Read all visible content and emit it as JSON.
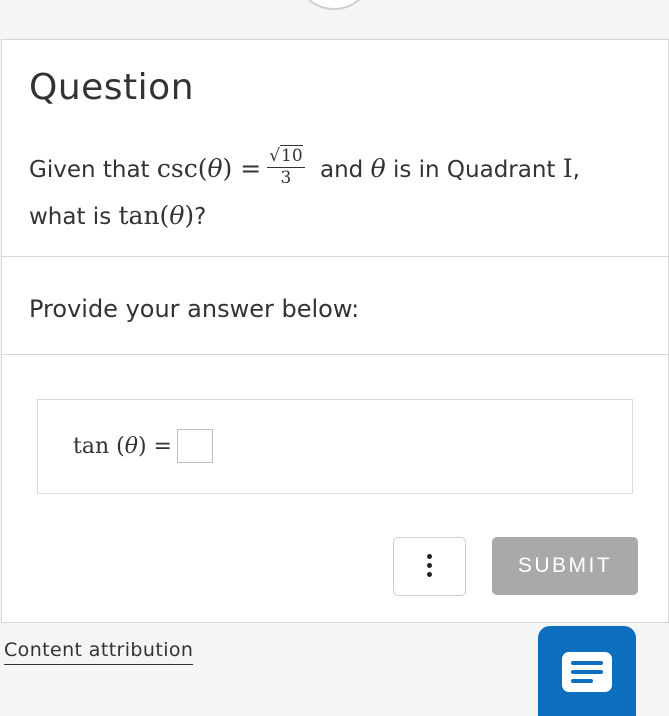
{
  "question": {
    "title": "Question",
    "prefix": "Given that ",
    "csc_expr": "csc(",
    "theta": "θ",
    "close_eq": ") =",
    "frac_num_root": "10",
    "frac_den": "3",
    "mid_text": " and ",
    "mid_theta": "θ",
    "mid_text2": " is in Quadrant ",
    "quadrant": "I",
    "comma": ",",
    "line2_prefix": "what is ",
    "tan_expr": "tan(",
    "tan_theta": "θ",
    "tan_close": ")",
    "qmark": "?"
  },
  "provide": {
    "label": "Provide your answer below:"
  },
  "answer": {
    "expression_prefix": "tan (",
    "expression_theta": "θ",
    "expression_suffix": ") =",
    "input_value": ""
  },
  "actions": {
    "submit_label": "SUBMIT",
    "more_icon": "vertical-ellipsis-icon"
  },
  "footer": {
    "attribution_label": "Content attribution",
    "chat_icon": "chat-icon"
  },
  "colors": {
    "accent": "#0c6ebd",
    "submit_disabled": "#a9a9a9",
    "border": "#d6d6d6"
  }
}
